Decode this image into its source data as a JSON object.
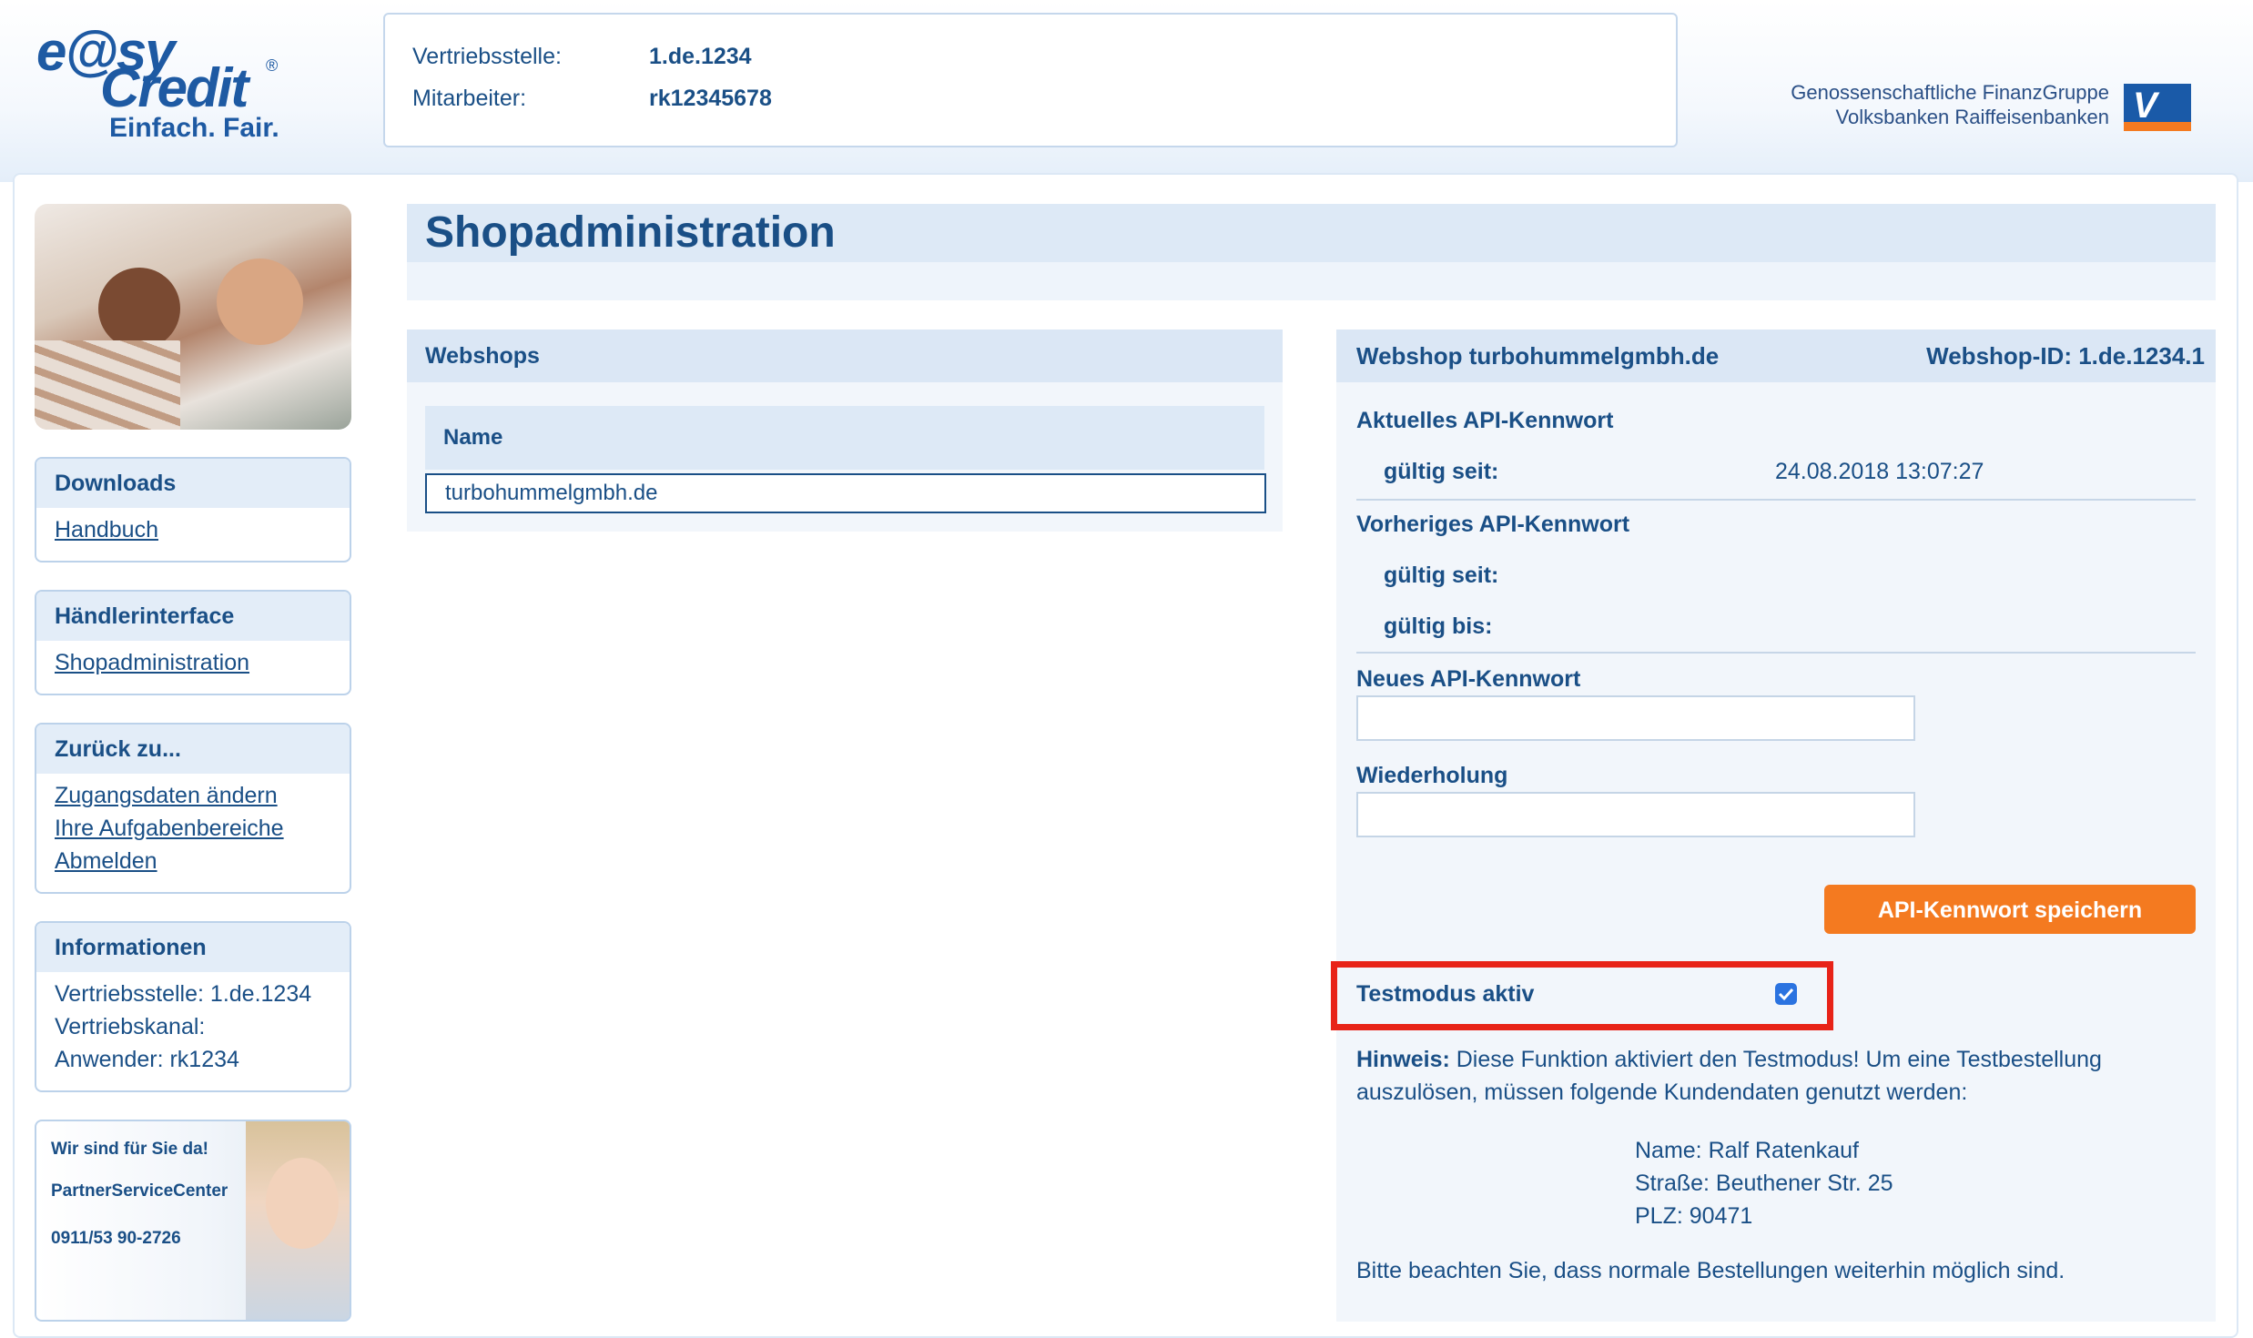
{
  "logo": {
    "line1": "e@sy",
    "line2": "Credit",
    "reg": "®",
    "tagline": "Einfach. Fair."
  },
  "header_info": {
    "vertriebsstelle_label": "Vertriebsstelle:",
    "vertriebsstelle_value": "1.de.1234",
    "mitarbeiter_label": "Mitarbeiter:",
    "mitarbeiter_value": "rk12345678"
  },
  "bank": {
    "line1": "Genossenschaftliche FinanzGruppe",
    "line2": "Volksbanken Raiffeisenbanken"
  },
  "sidebar": {
    "downloads": {
      "title": "Downloads",
      "links": [
        "Handbuch"
      ]
    },
    "haendler": {
      "title": "Händlerinterface",
      "links": [
        "Shopadministration"
      ]
    },
    "zurueck": {
      "title": "Zurück zu...",
      "links": [
        "Zugangsdaten ändern",
        "Ihre Aufgabenbereiche",
        "Abmelden"
      ]
    },
    "info": {
      "title": "Informationen",
      "lines": [
        "Vertriebsstelle: 1.de.1234",
        "Vertriebskanal:",
        "Anwender: rk1234"
      ]
    },
    "psc": {
      "line1": "Wir sind für Sie da!",
      "line2": "PartnerServiceCenter",
      "phone": "0911/53 90-2726"
    }
  },
  "page_title": "Shopadministration",
  "webshops": {
    "title": "Webshops",
    "column": "Name",
    "rows": [
      "turbohummelgmbh.de"
    ]
  },
  "detail": {
    "title_prefix": "Webshop",
    "title_name": "turbohummelgmbh.de",
    "shop_id": "Webshop-ID: 1.de.1234.1",
    "current_pw": "Aktuelles API-Kennwort",
    "gueltig_seit": "gültig seit:",
    "gueltig_bis": "gültig bis:",
    "current_since": "24.08.2018 13:07:27",
    "previous_pw": "Vorheriges API-Kennwort",
    "new_pw": "Neues API-Kennwort",
    "repeat": "Wiederholung",
    "save_button": "API-Kennwort speichern",
    "testmode_label": "Testmodus aktiv",
    "testmode_checked": true,
    "hint_label": "Hinweis:",
    "hint_text": "Diese Funktion aktiviert den Testmodus! Um eine Testbestellung auszulösen, müssen folgende Kundendaten genutzt werden:",
    "customer": [
      "Name: Ralf Ratenkauf",
      "Straße: Beuthener Str. 25",
      "PLZ: 90471"
    ],
    "footer": "Bitte beachten Sie, dass normale Bestellungen weiterhin möglich sind."
  },
  "colors": {
    "brand_blue": "#1a4f86",
    "accent_orange": "#f47a20",
    "highlight_red": "#e82318",
    "panel_bg": "#f2f6fb"
  }
}
